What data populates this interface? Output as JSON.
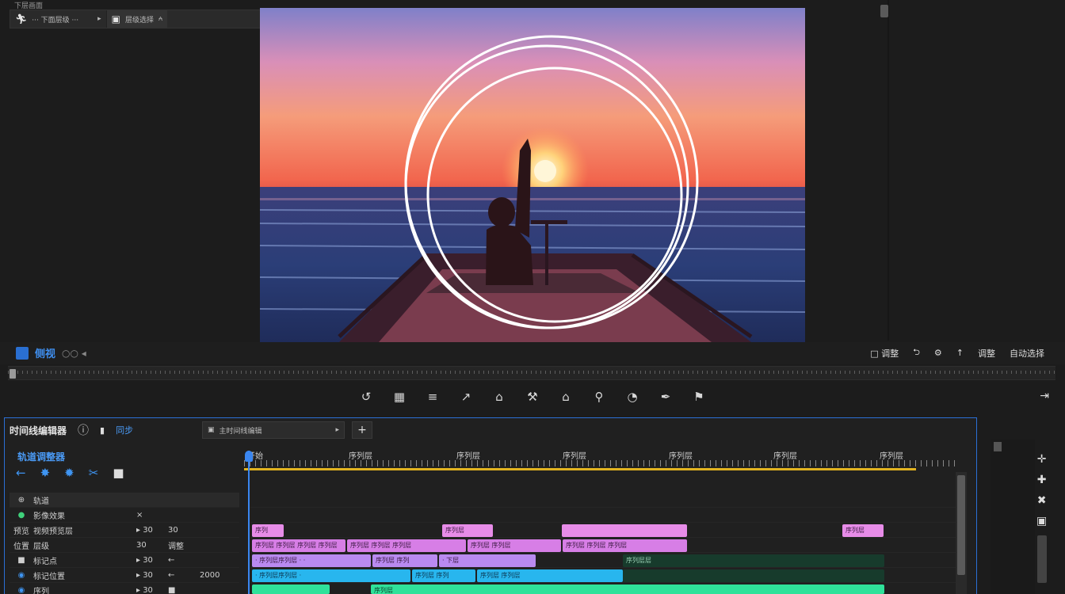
{
  "panel": {
    "label": "下层画面"
  },
  "topbar": {
    "left_icon": "run-icon",
    "left_text": "··· 下面层级 ···",
    "right_icon": "film-icon",
    "right_text": "层级选择"
  },
  "monitor": {
    "left_label": "侧视",
    "left_glyphs": "○○ ◂",
    "right_items": [
      "□ 调整",
      "⮌",
      "⚙",
      "↑",
      "调整",
      "自动选择"
    ]
  },
  "toolbar": {
    "tools": [
      "undo-icon",
      "grid-icon",
      "menu-icon",
      "select-icon",
      "lift-icon",
      "hammer-icon",
      "basket-icon",
      "search-icon",
      "clock-icon",
      "pen-icon",
      "flag-icon"
    ],
    "tool_glyphs": [
      "↺",
      "▦",
      "≡",
      "↗",
      "⌂",
      "⚒",
      "⌂",
      "⚲",
      "◔",
      "✒",
      "⚑"
    ],
    "end_glyph": "⇥"
  },
  "timeline": {
    "title": "时间线编辑器",
    "tab2": "同步",
    "dropdown": "主时间线编辑",
    "plus": "+",
    "subtitle": "轨道调整器",
    "ruler_labels": [
      "开始",
      "序列层",
      "序列层",
      "序列层",
      "序列层",
      "序列层",
      "序列层"
    ],
    "tracks": [
      {
        "c1": "⊕",
        "c2": "轨道",
        "c3": "",
        "c4": "",
        "c5": ""
      },
      {
        "c1": "●",
        "c2": "影像效果",
        "c3": "×",
        "c4": "",
        "c5": ""
      },
      {
        "c1": "预览",
        "c2": "视频预览层",
        "c3": "▸ 30",
        "c4": "30",
        "c5": ""
      },
      {
        "c1": "位置",
        "c2": "层级",
        "c3": "30",
        "c4": "调整",
        "c5": ""
      },
      {
        "c1": "■",
        "c2": "标记点",
        "c3": "▸ 30",
        "c4": "←",
        "c5": ""
      },
      {
        "c1": "◉",
        "c2": "标记位置",
        "c3": "▸ 30",
        "c4": "←",
        "c5": "2000"
      },
      {
        "c1": "◉",
        "c2": "序列",
        "c3": "▸ 30",
        "c4": "■",
        "c5": ""
      }
    ],
    "clips": {
      "lane2": [
        "序列",
        "序列层",
        "",
        "序列层"
      ],
      "lane3": [
        "序列层 序列层 序列层 序列层",
        "序列层 序列层 序列层",
        "序列层 序列层",
        "序列层 序列层 序列层"
      ],
      "lane4": [
        "· 序列层序列层 · ·",
        "序列层 序列",
        "· 下层",
        "序列层层"
      ],
      "lane5": [
        "· 序列层序列层 ·",
        "序列层 序列",
        "序列层 序列层"
      ],
      "lane6": [
        "",
        "序列层"
      ]
    }
  },
  "colors": {
    "accent": "#2b6fd6",
    "playhead": "#3a86f0",
    "work_area": "#e2b320"
  }
}
